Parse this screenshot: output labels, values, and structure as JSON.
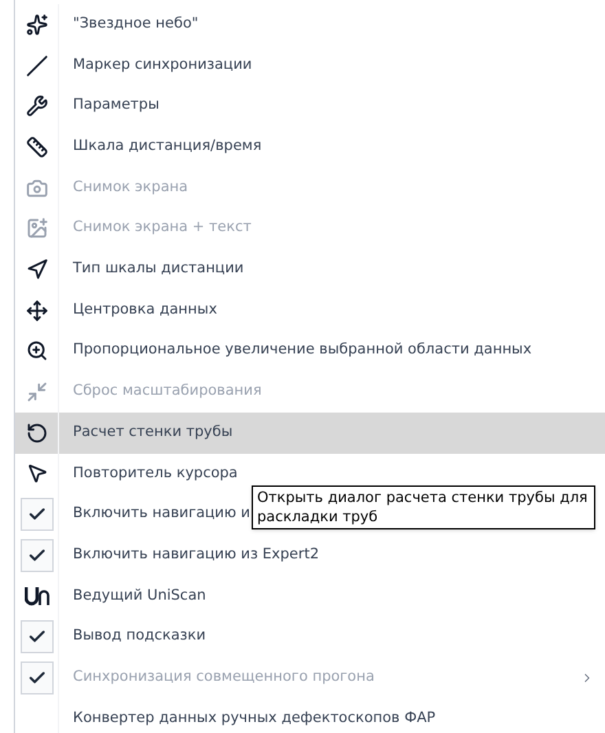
{
  "menu": {
    "items": [
      {
        "label": "\"Звездное небо\"",
        "disabled": false,
        "checked": false,
        "selected": false,
        "submenu": false
      },
      {
        "label": "Маркер синхронизации",
        "disabled": false,
        "checked": false,
        "selected": false,
        "submenu": false
      },
      {
        "label": "Параметры",
        "disabled": false,
        "checked": false,
        "selected": false,
        "submenu": false
      },
      {
        "label": "Шкала дистанция/время",
        "disabled": false,
        "checked": false,
        "selected": false,
        "submenu": false
      },
      {
        "label": "Снимок экрана",
        "disabled": true,
        "checked": false,
        "selected": false,
        "submenu": false
      },
      {
        "label": "Снимок экрана + текст",
        "disabled": true,
        "checked": false,
        "selected": false,
        "submenu": false
      },
      {
        "label": "Тип шкалы дистанции",
        "disabled": false,
        "checked": false,
        "selected": false,
        "submenu": false
      },
      {
        "label": "Центровка данных",
        "disabled": false,
        "checked": false,
        "selected": false,
        "submenu": false
      },
      {
        "label": "Пропорциональное увеличение выбранной области данных",
        "disabled": false,
        "checked": false,
        "selected": false,
        "submenu": false
      },
      {
        "label": "Сброс масштабирования",
        "disabled": true,
        "checked": false,
        "selected": false,
        "submenu": false
      },
      {
        "label": "Расчет стенки трубы",
        "disabled": false,
        "checked": false,
        "selected": true,
        "submenu": false
      },
      {
        "label": "Повторитель курсора",
        "disabled": false,
        "checked": false,
        "selected": false,
        "submenu": false
      },
      {
        "label": "Включить навигацию и",
        "disabled": false,
        "checked": true,
        "selected": false,
        "submenu": false
      },
      {
        "label": "Включить навигацию из Expert2",
        "disabled": false,
        "checked": true,
        "selected": false,
        "submenu": false
      },
      {
        "label": "Ведущий UniScan",
        "disabled": false,
        "checked": false,
        "selected": false,
        "submenu": false
      },
      {
        "label": "Вывод подсказки",
        "disabled": false,
        "checked": true,
        "selected": false,
        "submenu": false
      },
      {
        "label": "Синхронизация совмещенного прогона",
        "disabled": true,
        "checked": true,
        "selected": false,
        "submenu": true
      },
      {
        "label": "Конвертер данных ручных дефектоскопов ФАР",
        "disabled": false,
        "checked": false,
        "selected": false,
        "submenu": false
      }
    ]
  },
  "tooltip": {
    "text": "Открыть диалог расчета стенки трубы для раскладки труб"
  }
}
